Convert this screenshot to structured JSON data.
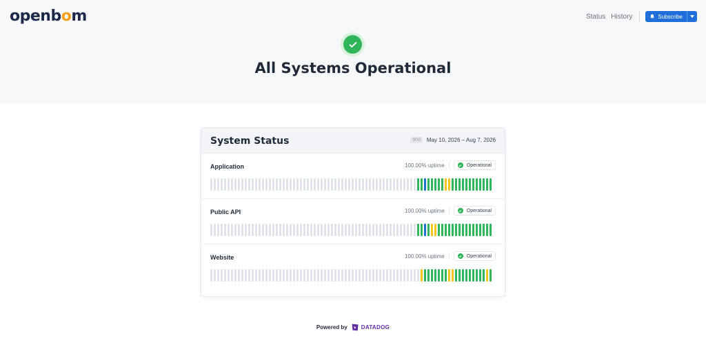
{
  "brand": {
    "name_part1": "openb",
    "name_o": "o",
    "name_part2": "m",
    "accent": "#f4a01a",
    "color": "#1b2a4a"
  },
  "nav": {
    "links": [
      "Status",
      "History"
    ],
    "subscribe_label": "Subscribe",
    "subscribe_icon": "bell-icon",
    "caret_icon": "caret-down-icon"
  },
  "hero": {
    "icon": "check-circle-icon",
    "title": "All Systems Operational"
  },
  "panel": {
    "title": "System Status",
    "range_badge": "90d",
    "range_text": "May 10, 2026 – Aug 7, 2026",
    "components": [
      {
        "name": "Application",
        "uptime": "100.00% uptime",
        "status": "Operational",
        "bars": "nnnnnnnnnnnnnnnnnnnnnnnnnnnnnnnnnnnnnnnnnnnnnnnnnnnnnnnnnnnnggbgggggyygggggggggggg"
      },
      {
        "name": "Public API",
        "uptime": "100.00% uptime",
        "status": "Operational",
        "bars": "nnnnnnnnnnnnnnnnnnnnnnnnnnnnnnnnnnnnnnnnnnnnnnnnnnnnnnnnnnnnggbgyygggggggggggggggg"
      },
      {
        "name": "Website",
        "uptime": "100.00% uptime",
        "status": "Operational",
        "bars": "nnnnnnnnnnnnnnnnnnnnnnnnnnnnnnnnnnnnnnnnnnnnnnnnnnnnnnnnnnnnnygggggggyygggggggggyg"
      }
    ],
    "bar_colors": {
      "n": "#e1e4ea",
      "g": "#31b55a",
      "y": "#f4c51a",
      "b": "#1e6fd9"
    }
  },
  "footer": {
    "powered_label": "Powered by",
    "vendor": "DATADOG",
    "vendor_icon": "datadog-logo-icon",
    "vendor_color": "#632ca6"
  }
}
